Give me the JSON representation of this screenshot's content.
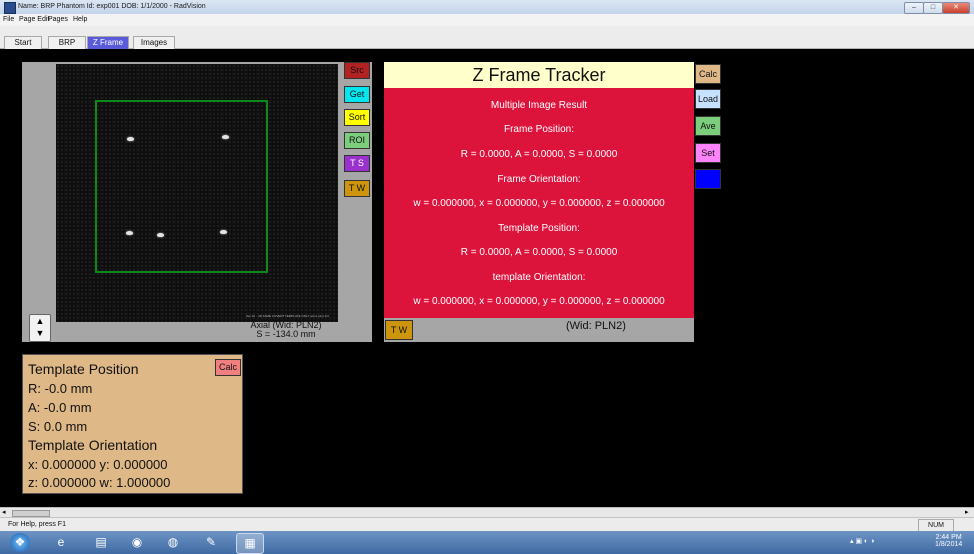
{
  "window": {
    "title": "Name: BRP Phantom   Id: exp001   DOB: 1/1/2000 - RadVision"
  },
  "menu": [
    "File",
    "Page Edit",
    "Pages",
    "Help"
  ],
  "tabs": [
    {
      "label": "Start",
      "active": false
    },
    {
      "label": "BRP",
      "active": false
    },
    {
      "label": "Z Frame",
      "active": true
    },
    {
      "label": "Images",
      "active": false
    }
  ],
  "image_view": {
    "caption_small": "Ser 10 ...3D FAME COVERT TEMPLATE ONLY at loc (Ax) 1/4",
    "axial_label": "Axial (Wid: PLN2)",
    "slice_label": "S = -134.0 mm",
    "spinner_up": "▲",
    "spinner_down": "▼"
  },
  "side_buttons": [
    {
      "label": "Src",
      "color": "#b22222"
    },
    {
      "label": "Get",
      "color": "#00e5ee"
    },
    {
      "label": "Sort",
      "color": "#ffff00"
    },
    {
      "label": "ROI",
      "color": "#7ccd7c"
    },
    {
      "label": "T S",
      "color": "#9932cc"
    },
    {
      "label": "T W",
      "color": "#cd950c"
    }
  ],
  "tracker": {
    "title": "Z Frame Tracker",
    "lines": [
      "Multiple Image Result",
      "Frame Position:",
      "R = 0.0000, A = 0.0000, S = 0.0000",
      "Frame Orientation:",
      "w = 0.000000, x = 0.000000, y = 0.000000, z = 0.000000",
      "Template Position:",
      "R = 0.0000, A = 0.0000, S = 0.0000",
      "template Orientation:",
      "w = 0.000000, x = 0.000000, y = 0.000000, z = 0.000000"
    ],
    "wid_label": "(Wid: PLN2)",
    "tw_button": "T W",
    "buttons": [
      {
        "label": "Calc",
        "color": "#deb887"
      },
      {
        "label": "Load",
        "color": "#c6e2ff"
      },
      {
        "label": "Ave",
        "color": "#7ccd7c"
      },
      {
        "label": "Set",
        "color": "#ff83fa"
      },
      {
        "label": "",
        "color": "#0000ff"
      }
    ]
  },
  "template_panel": {
    "title": "Template Position",
    "calc_button": "Calc",
    "r": "R: -0.0  mm",
    "a": "A: -0.0  mm",
    "s": "S: 0.0  mm",
    "orientation_title": "Template Orientation",
    "xy": "x: 0.000000  y: 0.000000",
    "zw": "z: 0.000000  w: 1.000000"
  },
  "status": {
    "help_text": "For Help, press F1",
    "num": "NUM"
  },
  "taskbar": {
    "time": "2:44 PM",
    "date": "1/8/2014"
  }
}
